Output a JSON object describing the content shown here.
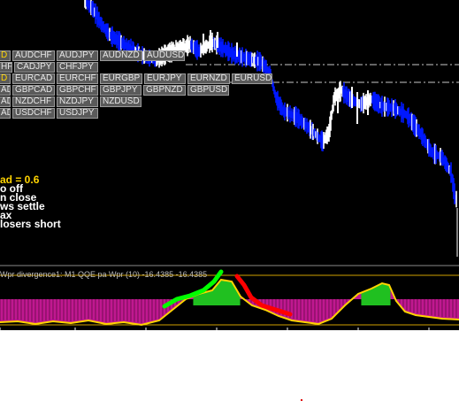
{
  "pair_buttons": [
    {
      "label": "AUDCHF",
      "active": false
    },
    {
      "label": "AUDJPY",
      "active": false
    },
    {
      "label": "AUDNZD",
      "active": false
    },
    {
      "label": "AUDUSD",
      "active": false
    },
    {
      "label": "CADJPY",
      "active": false
    },
    {
      "label": "CHFJPY",
      "active": false
    },
    {
      "label": "EURCAD",
      "active": false
    },
    {
      "label": "EURCHF",
      "active": false
    },
    {
      "label": "EURGBP",
      "active": false
    },
    {
      "label": "EURJPY",
      "active": false
    },
    {
      "label": "EURNZD",
      "active": false
    },
    {
      "label": "EURUSD",
      "active": false
    },
    {
      "label": "GBPCAD",
      "active": false
    },
    {
      "label": "GBPCHF",
      "active": false
    },
    {
      "label": "GBPJPY",
      "active": false
    },
    {
      "label": "GBPNZD",
      "active": false
    },
    {
      "label": "GBPUSD",
      "active": false
    },
    {
      "label": "NZDCHF",
      "active": false
    },
    {
      "label": "NZDJPY",
      "active": false
    },
    {
      "label": "NZDUSD",
      "active": false
    },
    {
      "label": "USDCHF",
      "active": false
    },
    {
      "label": "USDJPY",
      "active": false
    }
  ],
  "partial_buttons": [
    {
      "label": "D",
      "active": true
    },
    {
      "label": "HF",
      "active": false
    },
    {
      "label": "D",
      "active": true
    },
    {
      "label": "AD",
      "active": false
    },
    {
      "label": "AD",
      "active": false
    },
    {
      "label": "AD",
      "active": false
    }
  ],
  "info_lines": [
    "ad = 0.6",
    "o off",
    "n close",
    "ws settle",
    "ax",
    " losers short"
  ],
  "indicator": {
    "title": "Wpr divergence1: M1  QQE pa Wpr (10) -16.4385 -16.4385"
  },
  "colors": {
    "background": "#000000",
    "bull_candle": "#ffffff",
    "bear_candle": "#0018ff",
    "histogram": "#c01890",
    "histogram_up": "#20c020",
    "qqe_line": "#ffd400",
    "bull_divergence": "#00ff00",
    "bear_divergence": "#ff0000",
    "level_line": "#c8c8c8"
  }
}
